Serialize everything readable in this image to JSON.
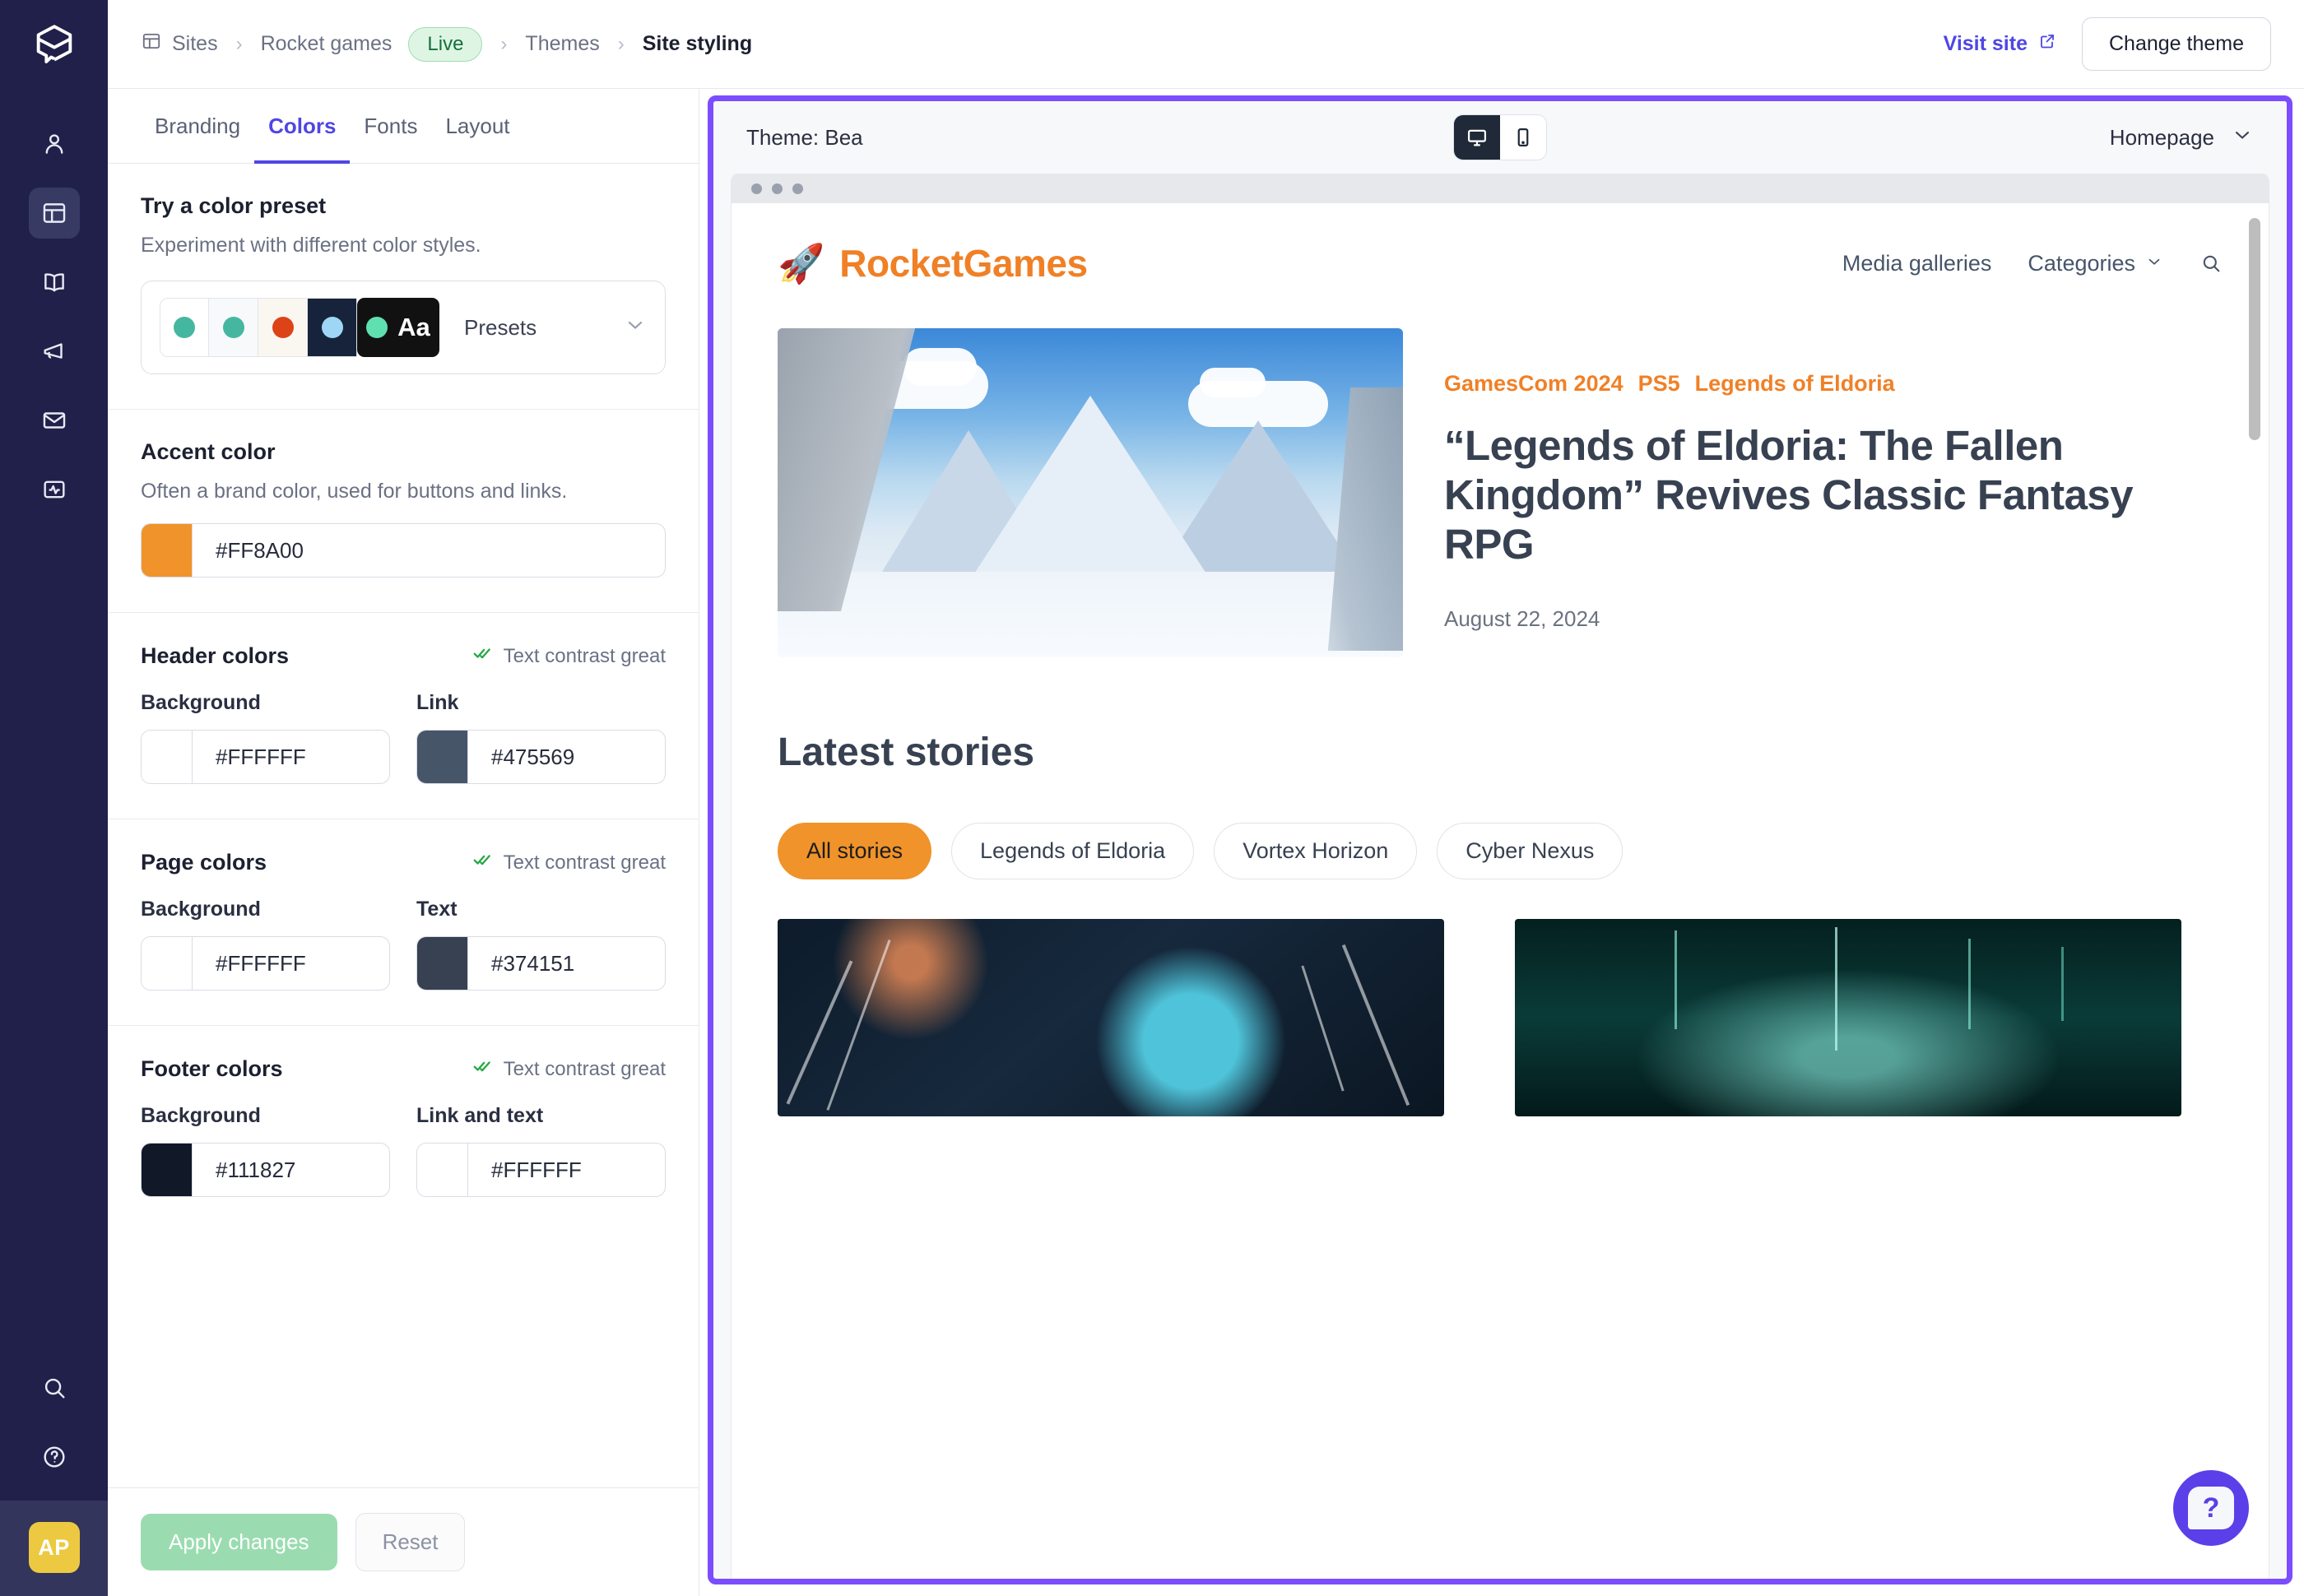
{
  "rail": {
    "logo_icon": "prezly-cube-logo",
    "items": [
      {
        "name": "contacts",
        "icon": "person-icon",
        "active": false
      },
      {
        "name": "sites",
        "icon": "layout-panel-icon",
        "active": true
      },
      {
        "name": "stories",
        "icon": "book-open-icon",
        "active": false
      },
      {
        "name": "campaigns",
        "icon": "megaphone-icon",
        "active": false
      },
      {
        "name": "emails",
        "icon": "envelope-icon",
        "active": false
      },
      {
        "name": "analytics",
        "icon": "activity-pulse-icon",
        "active": false
      }
    ],
    "bottom_items": [
      {
        "name": "search",
        "icon": "search-icon"
      },
      {
        "name": "help",
        "icon": "question-circle-icon"
      }
    ],
    "avatar_initials": "AP"
  },
  "topbar": {
    "breadcrumbs": [
      {
        "label": "Sites",
        "icon": "layout-panel-icon"
      },
      {
        "label": "Rocket games",
        "badge": "Live"
      },
      {
        "label": "Themes"
      },
      {
        "label": "Site styling",
        "current": true
      }
    ],
    "separator": "›",
    "visit_site_label": "Visit site",
    "visit_site_icon": "external-link-icon",
    "change_theme_label": "Change theme"
  },
  "panel": {
    "tabs": [
      {
        "label": "Branding",
        "active": false
      },
      {
        "label": "Colors",
        "active": true
      },
      {
        "label": "Fonts",
        "active": false
      },
      {
        "label": "Layout",
        "active": false
      }
    ],
    "preset": {
      "title": "Try a color preset",
      "subtitle": "Experiment with different color styles.",
      "swatches": [
        {
          "bg": "#FFFFFF",
          "dot": "#45B7A0"
        },
        {
          "bg": "#F7F9FB",
          "dot": "#45B7A0"
        },
        {
          "bg": "#FAF7F0",
          "dot": "#DC4418"
        },
        {
          "bg": "#16233B",
          "dot": "#9FD6F5"
        },
        {
          "bg": "#111111",
          "dot": "#5FE0B0",
          "label": "Aa",
          "label_color": "#FFFFFF"
        }
      ],
      "dropdown_label": "Presets",
      "dropdown_icon": "chevron-down-icon"
    },
    "accent": {
      "title": "Accent color",
      "subtitle": "Often a brand color, used for buttons and links.",
      "value": "#FF8A00"
    },
    "groups": [
      {
        "title": "Header colors",
        "contrast_label": "Text contrast great",
        "contrast_icon": "double-check-icon",
        "fields": [
          {
            "label": "Background",
            "value": "#FFFFFF"
          },
          {
            "label": "Link",
            "value": "#475569"
          }
        ]
      },
      {
        "title": "Page colors",
        "contrast_label": "Text contrast great",
        "contrast_icon": "double-check-icon",
        "fields": [
          {
            "label": "Background",
            "value": "#FFFFFF"
          },
          {
            "label": "Text",
            "value": "#374151"
          }
        ]
      },
      {
        "title": "Footer colors",
        "contrast_label": "Text contrast great",
        "contrast_icon": "double-check-icon",
        "fields": [
          {
            "label": "Background",
            "value": "#111827"
          },
          {
            "label": "Link and text",
            "value": "#FFFFFF"
          }
        ]
      }
    ],
    "footer": {
      "apply_label": "Apply changes",
      "reset_label": "Reset"
    }
  },
  "preview": {
    "theme_label": "Theme: Bea",
    "devices": [
      {
        "name": "desktop",
        "icon": "monitor-icon",
        "active": true
      },
      {
        "name": "mobile",
        "icon": "phone-icon",
        "active": false
      }
    ],
    "page_selector": "Homepage",
    "page_selector_icon": "chevron-down-icon",
    "site": {
      "brand_icon": "rocket-icon",
      "brand_name": "RocketGames",
      "nav": [
        {
          "label": "Media galleries",
          "has_chevron": false
        },
        {
          "label": "Categories",
          "has_chevron": true
        }
      ],
      "search_icon": "search-icon",
      "hero": {
        "image_alt": "snowy-mountain-valley-warrior",
        "tags": [
          "GamesCom 2024",
          "PS5",
          "Legends of Eldoria"
        ],
        "headline": "“Legends of Eldoria: The Fallen Kingdom” Revives Classic Fantasy RPG",
        "date": "August 22, 2024"
      },
      "latest": {
        "title": "Latest stories",
        "chips": [
          {
            "label": "All stories",
            "active": true
          },
          {
            "label": "Legends of Eldoria",
            "active": false
          },
          {
            "label": "Vortex Horizon",
            "active": false
          },
          {
            "label": "Cyber Nexus",
            "active": false
          }
        ],
        "cards": [
          {
            "image_alt": "spaceship-approaching-planet"
          },
          {
            "image_alt": "cyber-neon-corridor"
          }
        ]
      }
    },
    "help_icon": "question-mark-bubble-icon"
  }
}
